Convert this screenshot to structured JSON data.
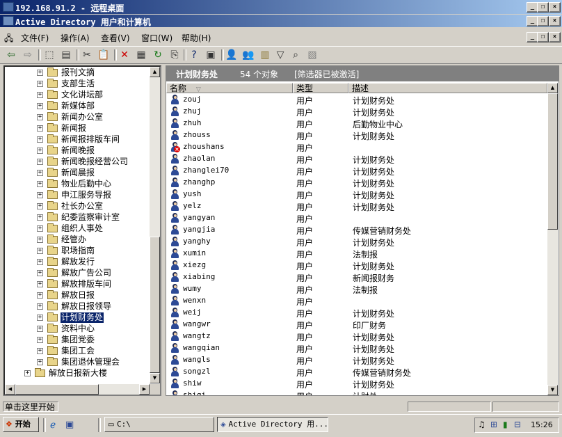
{
  "rdp_window": {
    "title": "192.168.91.2 - 远程桌面"
  },
  "app_window": {
    "title": "Active Directory 用户和计算机"
  },
  "menu": {
    "items": [
      {
        "label": "文件(F)"
      },
      {
        "label": "操作(A)"
      },
      {
        "label": "查看(V)"
      },
      {
        "label": "窗口(W)"
      },
      {
        "label": "帮助(H)"
      }
    ]
  },
  "toolbar": {
    "icons": [
      "back-icon",
      "forward-icon",
      "up-folder-icon",
      "show-tree-icon",
      "cut-icon",
      "paste-icon",
      "delete-icon",
      "properties-icon",
      "refresh-icon",
      "export-icon",
      "help-icon",
      "console-icon",
      "new-user-icon",
      "new-group-icon",
      "new-ou-icon",
      "filter-icon",
      "find-icon",
      "add-to-group-icon"
    ]
  },
  "tree": {
    "items": [
      {
        "label": "报刊文摘",
        "expander": "+"
      },
      {
        "label": "支部生活",
        "expander": "+"
      },
      {
        "label": "文化讲坛部",
        "expander": "+"
      },
      {
        "label": "新媒体部",
        "expander": "+"
      },
      {
        "label": "新闻办公室",
        "expander": "+"
      },
      {
        "label": "新闻报",
        "expander": "+"
      },
      {
        "label": "新闻报排版车间",
        "expander": "+"
      },
      {
        "label": "新闻晚报",
        "expander": "+"
      },
      {
        "label": "新闻晚报经营公司",
        "expander": "+"
      },
      {
        "label": "新闻晨报",
        "expander": "+"
      },
      {
        "label": "物业后勤中心",
        "expander": "+"
      },
      {
        "label": "申江服务导报",
        "expander": "+"
      },
      {
        "label": "社长办公室",
        "expander": "+"
      },
      {
        "label": "纪委监察审计室",
        "expander": "+"
      },
      {
        "label": "组织人事处",
        "expander": "+"
      },
      {
        "label": "经管办",
        "expander": "+"
      },
      {
        "label": "职场指南",
        "expander": "+"
      },
      {
        "label": "解放发行",
        "expander": "+"
      },
      {
        "label": "解放广告公司",
        "expander": "+"
      },
      {
        "label": "解放排版车间",
        "expander": "+"
      },
      {
        "label": "解放日报",
        "expander": "+"
      },
      {
        "label": "解放日报领导",
        "expander": "+"
      },
      {
        "label": "计划财务处",
        "expander": "+",
        "selected": true
      },
      {
        "label": "资料中心",
        "expander": "+"
      },
      {
        "label": "集团党委",
        "expander": "+"
      },
      {
        "label": "集团工会",
        "expander": "+"
      },
      {
        "label": "集团退休管理会",
        "expander": "+"
      }
    ],
    "parent_item": {
      "label": "解放日报新大楼",
      "expander": "+"
    }
  },
  "details": {
    "header_title": "计划财务处",
    "object_count": "54 个对象",
    "filter_note": "[筛选器已被激活]",
    "columns": {
      "name": "名称",
      "type": "类型",
      "desc": "描述"
    },
    "rows": [
      {
        "name": "zouj",
        "type": "用户",
        "desc": "计划财务处"
      },
      {
        "name": "zhuj",
        "type": "用户",
        "desc": "计划财务处"
      },
      {
        "name": "zhuh",
        "type": "用户",
        "desc": "后勤物业中心"
      },
      {
        "name": "zhouss",
        "type": "用户",
        "desc": "计划财务处"
      },
      {
        "name": "zhoushans",
        "type": "用户",
        "desc": "",
        "disabled": true
      },
      {
        "name": "zhaolan",
        "type": "用户",
        "desc": "计划财务处"
      },
      {
        "name": "zhanglei70",
        "type": "用户",
        "desc": "计划财务处"
      },
      {
        "name": "zhanghp",
        "type": "用户",
        "desc": "计划财务处"
      },
      {
        "name": "yush",
        "type": "用户",
        "desc": "计划财务处"
      },
      {
        "name": "yelz",
        "type": "用户",
        "desc": "计划财务处"
      },
      {
        "name": "yangyan",
        "type": "用户",
        "desc": ""
      },
      {
        "name": "yangjia",
        "type": "用户",
        "desc": "传媒营销财务处"
      },
      {
        "name": "yanghy",
        "type": "用户",
        "desc": "计划财务处"
      },
      {
        "name": "xumin",
        "type": "用户",
        "desc": "法制报"
      },
      {
        "name": "xiezg",
        "type": "用户",
        "desc": "计划财务处"
      },
      {
        "name": "xiabing",
        "type": "用户",
        "desc": "新闻报财务"
      },
      {
        "name": "wumy",
        "type": "用户",
        "desc": "法制报"
      },
      {
        "name": "wenxn",
        "type": "用户",
        "desc": ""
      },
      {
        "name": "weij",
        "type": "用户",
        "desc": "计划财务处"
      },
      {
        "name": "wangwr",
        "type": "用户",
        "desc": "印厂财务"
      },
      {
        "name": "wangtz",
        "type": "用户",
        "desc": "计划财务处"
      },
      {
        "name": "wangqian",
        "type": "用户",
        "desc": "计划财务处"
      },
      {
        "name": "wangls",
        "type": "用户",
        "desc": "计划财务处"
      },
      {
        "name": "songzl",
        "type": "用户",
        "desc": "传媒营销财务处"
      },
      {
        "name": "shiw",
        "type": "用户",
        "desc": "计划财务处"
      },
      {
        "name": "shiqi",
        "type": "用户",
        "desc": "计财处"
      }
    ]
  },
  "statusbar": {
    "text": "单击这里开始"
  },
  "taskbar": {
    "start_label": "开始",
    "tasks": [
      {
        "label": "C:\\"
      },
      {
        "label": "Active Directory 用..."
      }
    ],
    "clock": "15:26"
  }
}
